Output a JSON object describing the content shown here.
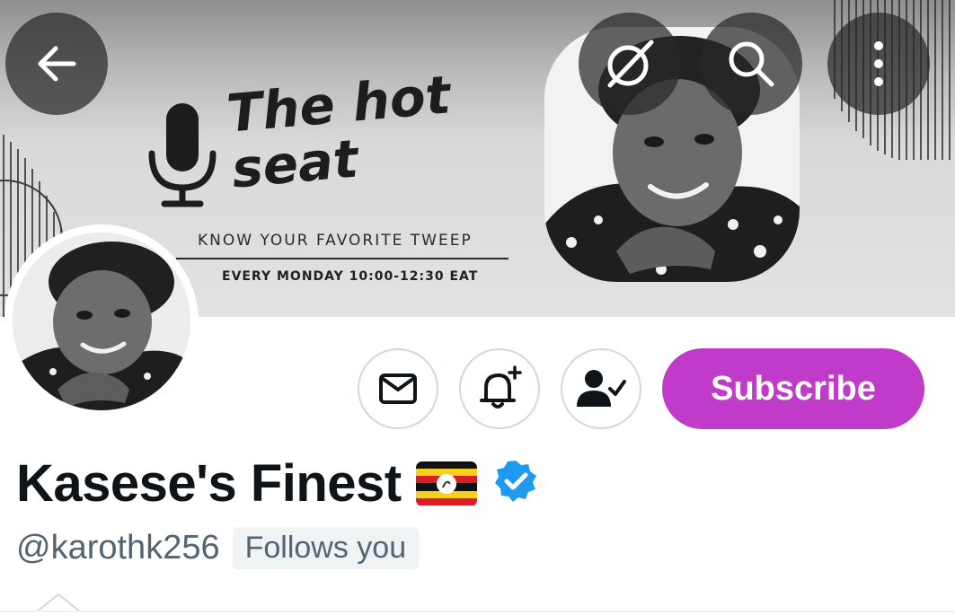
{
  "banner": {
    "title_line1": "The hot",
    "title_line2": "seat",
    "tagline": "KNOW YOUR FAVORITE TWEEP",
    "schedule": "EVERY MONDAY 10:00-12:30 EAT"
  },
  "header_buttons": {
    "back_icon": "arrow-left-icon",
    "grok_icon": "grok-icon",
    "search_icon": "search-icon",
    "more_icon": "more-vertical-icon"
  },
  "actions": {
    "message_icon": "envelope-icon",
    "notify_icon": "bell-plus-icon",
    "following_icon": "person-check-icon",
    "subscribe_label": "Subscribe"
  },
  "profile": {
    "display_name": "Kasese's Finest",
    "handle": "@karothk256",
    "follows_you": "Follows you"
  },
  "colors": {
    "subscribe": "#c13bcb",
    "verified": "#1d9bf0",
    "secondary_text": "#536471",
    "primary_text": "#0f1419"
  }
}
